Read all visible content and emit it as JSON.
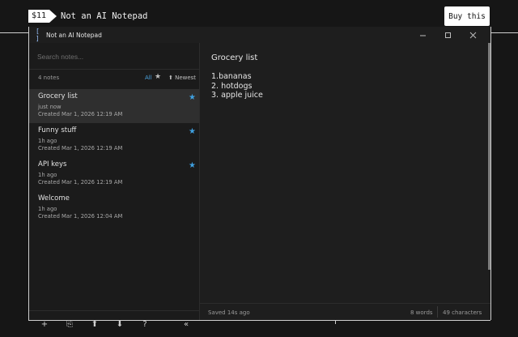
{
  "banner": {
    "price": "$11",
    "product_name": "Not an AI Notepad",
    "buy_label": "Buy this"
  },
  "window": {
    "title": "Not an AI Notepad",
    "icon": "brackets-icon",
    "controls": [
      "minimize-icon",
      "maximize-icon",
      "close-icon"
    ]
  },
  "sidebar": {
    "search_placeholder": "Search notes...",
    "note_count": "4 notes",
    "filter_all": "All",
    "filter_star": "★",
    "sort_label": "⬆ Newest",
    "notes": [
      {
        "title": "Grocery list",
        "time": "just now",
        "created": "Created Mar 1, 2026 12:19 AM",
        "starred": true,
        "active": true
      },
      {
        "title": "Funny stuff",
        "time": "1h ago",
        "created": "Created Mar 1, 2026 12:19 AM",
        "starred": true,
        "active": false
      },
      {
        "title": "API keys",
        "time": "1h ago",
        "created": "Created Mar 1, 2026 12:19 AM",
        "starred": true,
        "active": false
      },
      {
        "title": "Welcome",
        "time": "1h ago",
        "created": "Created Mar 1, 2026 12:04 AM",
        "starred": false,
        "active": false
      }
    ],
    "toolbar": {
      "add": "+",
      "import": "⎘",
      "move_up": "⬆",
      "move_down": "⬇",
      "help": "?",
      "collapse": "«"
    }
  },
  "editor": {
    "title": "Grocery list",
    "lines": [
      "1.bananas",
      "2. hotdogs",
      "3. apple juice"
    ]
  },
  "status": {
    "saved": "Saved 14s ago",
    "words": "8 words",
    "characters": "49 characters"
  },
  "colors": {
    "accent": "#3fa0e0",
    "background": "#1e1e1e",
    "sidebar": "#1b1b1b",
    "active_row": "#2f2f2f"
  }
}
